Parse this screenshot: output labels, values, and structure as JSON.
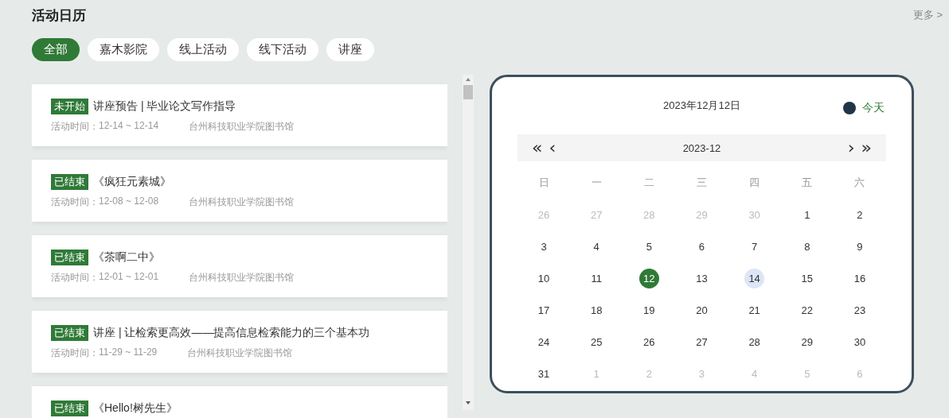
{
  "header": {
    "title": "活动日历",
    "more_link": "更多 >"
  },
  "tabs": [
    {
      "label": "全部",
      "selected": true
    },
    {
      "label": "嘉木影院",
      "selected": false
    },
    {
      "label": "线上活动",
      "selected": false
    },
    {
      "label": "线下活动",
      "selected": false
    },
    {
      "label": "讲座",
      "selected": false
    }
  ],
  "events": [
    {
      "status": "未开始",
      "title": "讲座预告 | 毕业论文写作指导",
      "time_label": "活动时间：",
      "time": "12-14 ~ 12-14",
      "location": "台州科技职业学院图书馆"
    },
    {
      "status": "已结束",
      "title": "《疯狂元素城》",
      "time_label": "活动时间：",
      "time": "12-08 ~ 12-08",
      "location": "台州科技职业学院图书馆"
    },
    {
      "status": "已结束",
      "title": "《茶啊二中》",
      "time_label": "活动时间：",
      "time": "12-01 ~ 12-01",
      "location": "台州科技职业学院图书馆"
    },
    {
      "status": "已结束",
      "title": "讲座 | 让检索更高效——提高信息检索能力的三个基本功",
      "time_label": "活动时间：",
      "time": "11-29 ~ 11-29",
      "location": "台州科技职业学院图书馆"
    },
    {
      "status": "已结束",
      "title": "《Hello!树先生》"
    }
  ],
  "calendar": {
    "current_date": "2023年12月12日",
    "legend": "今天",
    "month": "2023-12",
    "nav": {
      "prev_year": "«",
      "prev_month": "‹",
      "next_month": "›",
      "next_year": "»"
    },
    "weekdays": [
      "日",
      "一",
      "二",
      "三",
      "四",
      "五",
      "六"
    ],
    "weeks": [
      [
        {
          "day": "26",
          "muted": true,
          "selected": false,
          "has_event": false
        },
        {
          "day": "27",
          "muted": true,
          "selected": false,
          "has_event": false
        },
        {
          "day": "28",
          "muted": true,
          "selected": false,
          "has_event": false
        },
        {
          "day": "29",
          "muted": true,
          "selected": false,
          "has_event": false
        },
        {
          "day": "30",
          "muted": true,
          "selected": false,
          "has_event": false
        },
        {
          "day": "1",
          "muted": false,
          "selected": false,
          "has_event": false
        },
        {
          "day": "2",
          "muted": false,
          "selected": false,
          "has_event": false
        }
      ],
      [
        {
          "day": "3",
          "muted": false,
          "selected": false,
          "has_event": false
        },
        {
          "day": "4",
          "muted": false,
          "selected": false,
          "has_event": false
        },
        {
          "day": "5",
          "muted": false,
          "selected": false,
          "has_event": false
        },
        {
          "day": "6",
          "muted": false,
          "selected": false,
          "has_event": false
        },
        {
          "day": "7",
          "muted": false,
          "selected": false,
          "has_event": false
        },
        {
          "day": "8",
          "muted": false,
          "selected": false,
          "has_event": false
        },
        {
          "day": "9",
          "muted": false,
          "selected": false,
          "has_event": false
        }
      ],
      [
        {
          "day": "10",
          "muted": false,
          "selected": false,
          "has_event": false
        },
        {
          "day": "11",
          "muted": false,
          "selected": false,
          "has_event": false
        },
        {
          "day": "12",
          "muted": false,
          "selected": true,
          "has_event": false
        },
        {
          "day": "13",
          "muted": false,
          "selected": false,
          "has_event": false
        },
        {
          "day": "14",
          "muted": false,
          "selected": false,
          "has_event": true
        },
        {
          "day": "15",
          "muted": false,
          "selected": false,
          "has_event": false
        },
        {
          "day": "16",
          "muted": false,
          "selected": false,
          "has_event": false
        }
      ],
      [
        {
          "day": "17",
          "muted": false,
          "selected": false,
          "has_event": false
        },
        {
          "day": "18",
          "muted": false,
          "selected": false,
          "has_event": false
        },
        {
          "day": "19",
          "muted": false,
          "selected": false,
          "has_event": false
        },
        {
          "day": "20",
          "muted": false,
          "selected": false,
          "has_event": false
        },
        {
          "day": "21",
          "muted": false,
          "selected": false,
          "has_event": false
        },
        {
          "day": "22",
          "muted": false,
          "selected": false,
          "has_event": false
        },
        {
          "day": "23",
          "muted": false,
          "selected": false,
          "has_event": false
        }
      ],
      [
        {
          "day": "24",
          "muted": false,
          "selected": false,
          "has_event": false
        },
        {
          "day": "25",
          "muted": false,
          "selected": false,
          "has_event": false
        },
        {
          "day": "26",
          "muted": false,
          "selected": false,
          "has_event": false
        },
        {
          "day": "27",
          "muted": false,
          "selected": false,
          "has_event": false
        },
        {
          "day": "28",
          "muted": false,
          "selected": false,
          "has_event": false
        },
        {
          "day": "29",
          "muted": false,
          "selected": false,
          "has_event": false
        },
        {
          "day": "30",
          "muted": false,
          "selected": false,
          "has_event": false
        }
      ],
      [
        {
          "day": "31",
          "muted": false,
          "selected": false,
          "has_event": false
        },
        {
          "day": "1",
          "muted": true,
          "selected": false,
          "has_event": false
        },
        {
          "day": "2",
          "muted": true,
          "selected": false,
          "has_event": false
        },
        {
          "day": "3",
          "muted": true,
          "selected": false,
          "has_event": false
        },
        {
          "day": "4",
          "muted": true,
          "selected": false,
          "has_event": false
        },
        {
          "day": "5",
          "muted": true,
          "selected": false,
          "has_event": false
        },
        {
          "day": "6",
          "muted": true,
          "selected": false,
          "has_event": false
        }
      ]
    ]
  }
}
